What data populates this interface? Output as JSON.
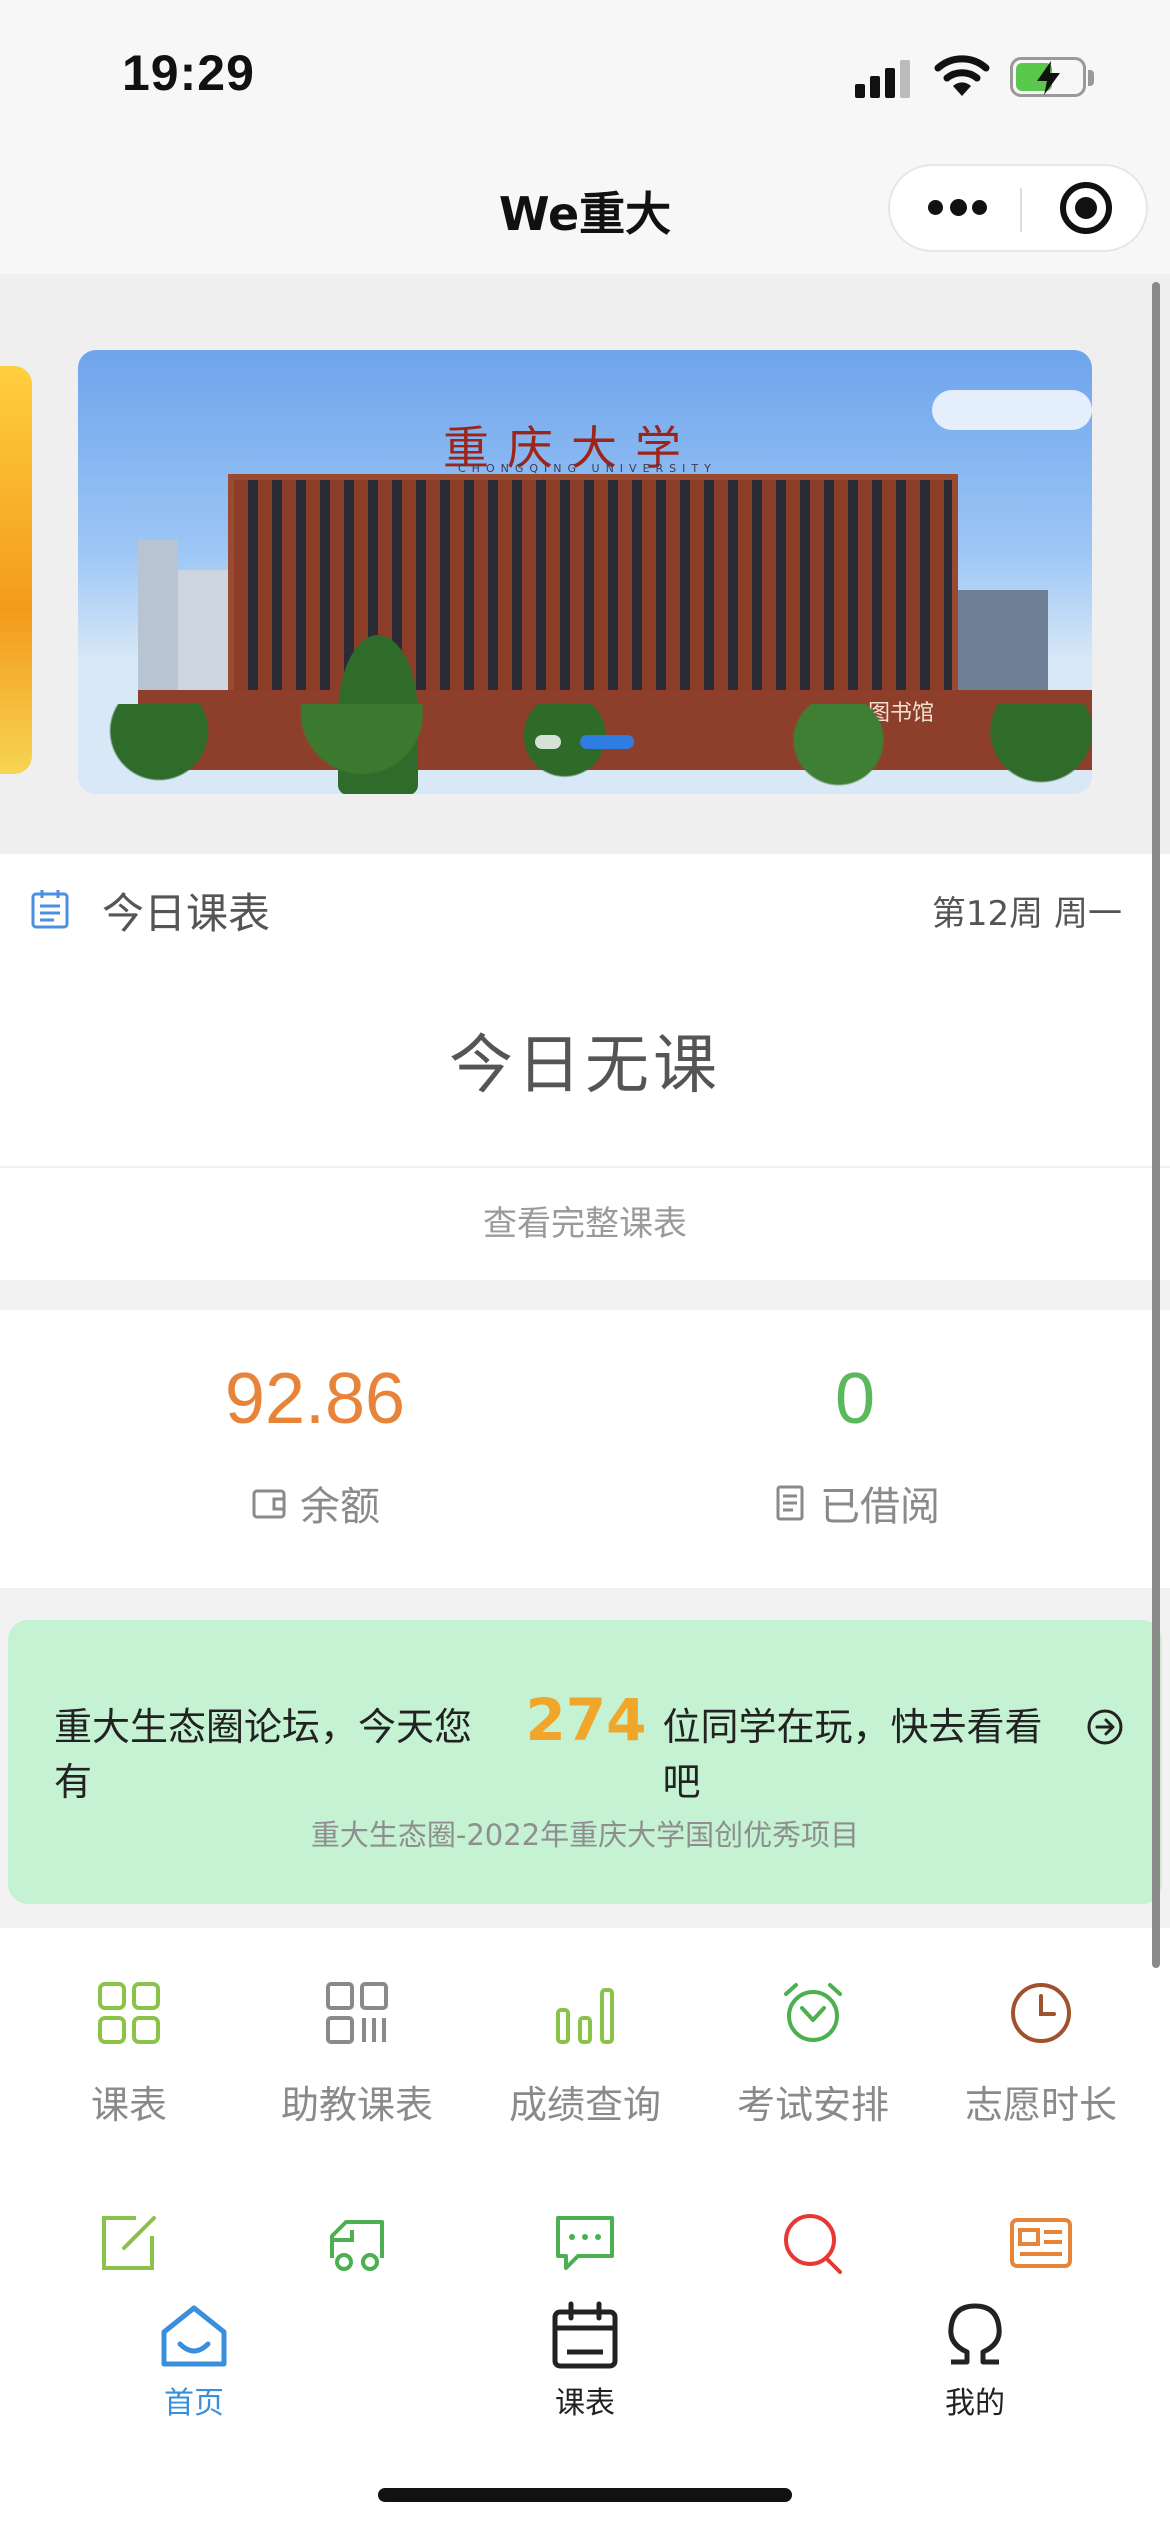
{
  "status_bar": {
    "time": "19:29"
  },
  "navbar": {
    "title": "We重大"
  },
  "schedule": {
    "heading": "今日课表",
    "week_info": "第12周 周一",
    "empty_text": "今日无课",
    "view_all": "查看完整课表"
  },
  "stats": {
    "balance_value": "92.86",
    "balance_label": "余额",
    "borrowed_value": "0",
    "borrowed_label": "已借阅",
    "balance_color": "#e8843a",
    "borrowed_color": "#5cb85c"
  },
  "forum": {
    "text_before": "重大生态圈论坛，今天您有",
    "online_count": "274",
    "text_after": "位同学在玩，快去看看吧",
    "subtitle": "重大生态圈-2022年重庆大学国创优秀项目"
  },
  "grid": {
    "items": [
      {
        "label": "课表",
        "icon": "grid-icon",
        "color": "#8bc34a"
      },
      {
        "label": "助教课表",
        "icon": "qr-grid-icon",
        "color": "#8a8a8a"
      },
      {
        "label": "成绩查询",
        "icon": "bar-chart-icon",
        "color": "#8bc34a"
      },
      {
        "label": "考试安排",
        "icon": "alarm-clock-icon",
        "color": "#4caf50"
      },
      {
        "label": "志愿时长",
        "icon": "clock-icon",
        "color": "#a0522d"
      }
    ],
    "row2_icons": [
      {
        "icon": "edit-icon",
        "color": "#8bc34a"
      },
      {
        "icon": "truck-icon",
        "color": "#4caf50"
      },
      {
        "icon": "chat-icon",
        "color": "#4caf50"
      },
      {
        "icon": "search-icon",
        "color": "#e53935"
      },
      {
        "icon": "news-icon",
        "color": "#e8843a"
      }
    ]
  },
  "banner": {
    "campus_name": "重庆大学",
    "campus_name_en": "CHONGQING UNIVERSITY",
    "library_sign": "图书馆"
  },
  "tabbar": {
    "home": "首页",
    "schedule": "课表",
    "mine": "我的",
    "active_color": "#3a8fdc"
  }
}
